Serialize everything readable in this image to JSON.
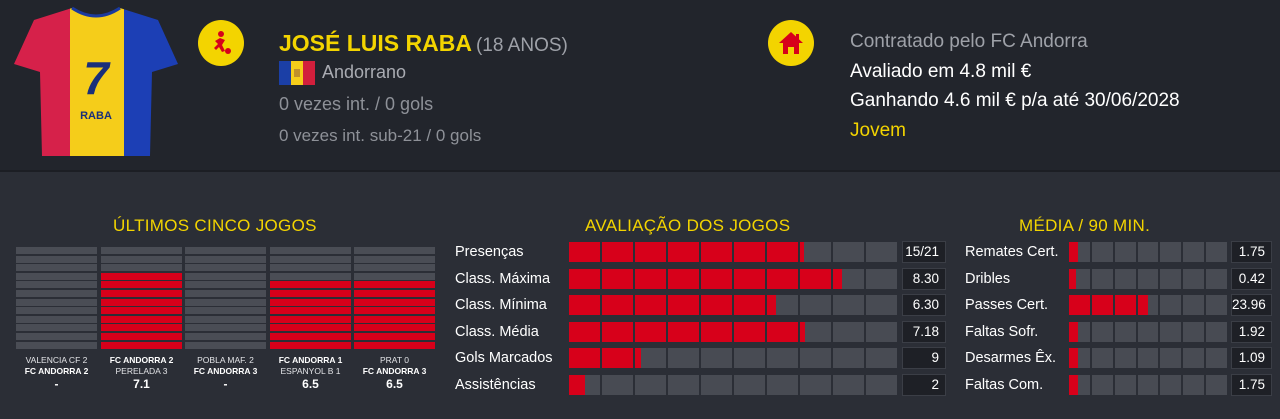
{
  "player": {
    "name": "JOSÉ LUIS RABA",
    "age": "(18 ANOS)",
    "nationality": "Andorrano",
    "caps": "0 vezes int. / 0 gols",
    "caps_u21": "0 vezes int. sub-21 / 0 gols",
    "shirt_number": "7",
    "shirt_name": "RABA"
  },
  "contract": {
    "club_line": "Contratado pelo FC Andorra",
    "value_line": "Avaliado em 4.8 mil €",
    "wage_line": "Ganhando 4.6 mil € p/a até 30/06/2028",
    "status": "Jovem"
  },
  "icons": {
    "player_icon": "football-player-icon",
    "club_icon": "home-icon",
    "flag": "andorra-flag"
  },
  "colors": {
    "accent": "#f3d400",
    "bar_fill": "#d7001a",
    "bar_empty": "#484b53",
    "background": "#2b2e36",
    "header_background": "#22252c"
  },
  "sections": {
    "last_five": "ÚLTIMOS CINCO JOGOS",
    "ratings": "AVALIAÇÃO DOS JOGOS",
    "per90": "MÉDIA / 90 MIN."
  },
  "last_five_matches": [
    {
      "line1": "VALENCIA CF 2",
      "line2": "FC ANDORRA 2",
      "line1_bold": false,
      "line2_bold": true,
      "rating": "-",
      "rating_fraction": 0
    },
    {
      "line1": "FC ANDORRA 2",
      "line2": "PERELADA 3",
      "line1_bold": true,
      "line2_bold": false,
      "rating": "7.1",
      "rating_fraction": 0.71
    },
    {
      "line1": "POBLA MAF. 2",
      "line2": "FC ANDORRA 3",
      "line1_bold": false,
      "line2_bold": true,
      "rating": "-",
      "rating_fraction": 0
    },
    {
      "line1": "FC ANDORRA 1",
      "line2": "ESPANYOL B 1",
      "line1_bold": true,
      "line2_bold": false,
      "rating": "6.5",
      "rating_fraction": 0.65
    },
    {
      "line1": "PRAT 0",
      "line2": "FC ANDORRA 3",
      "line1_bold": false,
      "line2_bold": true,
      "rating": "6.5",
      "rating_fraction": 0.65
    }
  ],
  "match_ratings": [
    {
      "label": "Presenças",
      "value": "15/21",
      "fraction": 0.714
    },
    {
      "label": "Class. Máxima",
      "value": "8.30",
      "fraction": 0.83
    },
    {
      "label": "Class. Mínima",
      "value": "6.30",
      "fraction": 0.63
    },
    {
      "label": "Class. Média",
      "value": "7.18",
      "fraction": 0.718
    },
    {
      "label": "Gols Marcados",
      "value": "9",
      "fraction": 0.22
    },
    {
      "label": "Assistências",
      "value": "2",
      "fraction": 0.05
    }
  ],
  "per90_stats": [
    {
      "label": "Remates Cert.",
      "value": "1.75",
      "fraction": 0.06
    },
    {
      "label": "Dribles",
      "value": "0.42",
      "fraction": 0.05
    },
    {
      "label": "Passes Cert.",
      "value": "23.96",
      "fraction": 0.5
    },
    {
      "label": "Faltas Sofr.",
      "value": "1.92",
      "fraction": 0.06
    },
    {
      "label": "Desarmes Êx.",
      "value": "1.09",
      "fraction": 0.06
    },
    {
      "label": "Faltas Com.",
      "value": "1.75",
      "fraction": 0.06
    }
  ]
}
